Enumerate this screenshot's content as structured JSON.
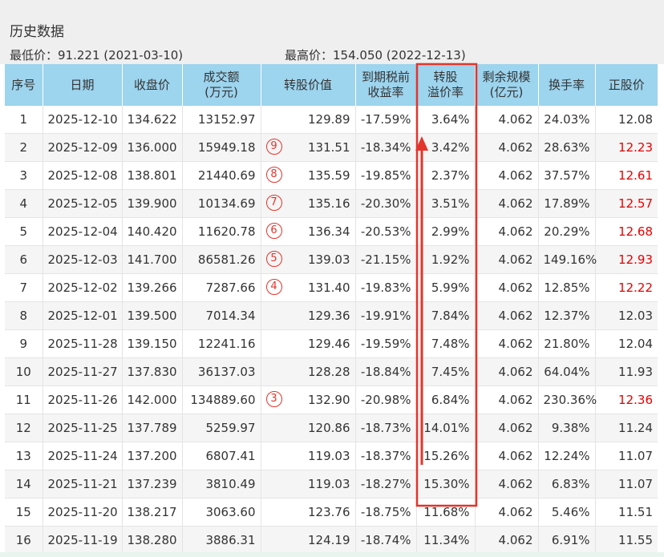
{
  "title": "历史数据",
  "low_price": "最低价：91.221 (2021-03-10)",
  "high_price": "最高价：154.050 (2022-12-13)",
  "headers": {
    "seq": "序号",
    "date": "日期",
    "close": "收盘价",
    "amount_1": "成交额",
    "amount_2": "(万元)",
    "conv_value": "转股价值",
    "ytm_1": "到期税前",
    "ytm_2": "收益率",
    "premium_1": "转股",
    "premium_2": "溢价率",
    "remaining_1": "剩余规模",
    "remaining_2": "(亿元)",
    "turnover": "换手率",
    "stock_price": "正股价"
  },
  "rows": [
    {
      "seq": "1",
      "date": "2025-12-10",
      "close": "134.622",
      "amount": "13152.97",
      "mark": "",
      "conv_value": "129.89",
      "ytm": "-17.59%",
      "premium": "3.64%",
      "remaining": "4.062",
      "turnover": "24.03%",
      "stock_price": "12.08",
      "stock_red": false
    },
    {
      "seq": "2",
      "date": "2025-12-09",
      "close": "136.000",
      "amount": "15949.18",
      "mark": "9",
      "conv_value": "131.51",
      "ytm": "-18.34%",
      "premium": "3.42%",
      "remaining": "4.062",
      "turnover": "28.63%",
      "stock_price": "12.23",
      "stock_red": true
    },
    {
      "seq": "3",
      "date": "2025-12-08",
      "close": "138.801",
      "amount": "21440.69",
      "mark": "8",
      "conv_value": "135.59",
      "ytm": "-19.85%",
      "premium": "2.37%",
      "remaining": "4.062",
      "turnover": "37.57%",
      "stock_price": "12.61",
      "stock_red": true
    },
    {
      "seq": "4",
      "date": "2025-12-05",
      "close": "139.900",
      "amount": "10134.69",
      "mark": "7",
      "conv_value": "135.16",
      "ytm": "-20.30%",
      "premium": "3.51%",
      "remaining": "4.062",
      "turnover": "17.89%",
      "stock_price": "12.57",
      "stock_red": true
    },
    {
      "seq": "5",
      "date": "2025-12-04",
      "close": "140.420",
      "amount": "11620.78",
      "mark": "6",
      "conv_value": "136.34",
      "ytm": "-20.53%",
      "premium": "2.99%",
      "remaining": "4.062",
      "turnover": "20.29%",
      "stock_price": "12.68",
      "stock_red": true
    },
    {
      "seq": "6",
      "date": "2025-12-03",
      "close": "141.700",
      "amount": "86581.26",
      "mark": "5",
      "conv_value": "139.03",
      "ytm": "-21.15%",
      "premium": "1.92%",
      "remaining": "4.062",
      "turnover": "149.16%",
      "stock_price": "12.93",
      "stock_red": true
    },
    {
      "seq": "7",
      "date": "2025-12-02",
      "close": "139.266",
      "amount": "7287.66",
      "mark": "4",
      "conv_value": "131.40",
      "ytm": "-19.83%",
      "premium": "5.99%",
      "remaining": "4.062",
      "turnover": "12.85%",
      "stock_price": "12.22",
      "stock_red": true
    },
    {
      "seq": "8",
      "date": "2025-12-01",
      "close": "139.500",
      "amount": "7014.34",
      "mark": "",
      "conv_value": "129.36",
      "ytm": "-19.91%",
      "premium": "7.84%",
      "remaining": "4.062",
      "turnover": "12.37%",
      "stock_price": "12.03",
      "stock_red": false
    },
    {
      "seq": "9",
      "date": "2025-11-28",
      "close": "139.150",
      "amount": "12241.16",
      "mark": "",
      "conv_value": "129.46",
      "ytm": "-19.59%",
      "premium": "7.48%",
      "remaining": "4.062",
      "turnover": "21.80%",
      "stock_price": "12.04",
      "stock_red": false
    },
    {
      "seq": "10",
      "date": "2025-11-27",
      "close": "137.830",
      "amount": "36137.03",
      "mark": "",
      "conv_value": "128.28",
      "ytm": "-18.84%",
      "premium": "7.45%",
      "remaining": "4.062",
      "turnover": "64.04%",
      "stock_price": "11.93",
      "stock_red": false
    },
    {
      "seq": "11",
      "date": "2025-11-26",
      "close": "142.000",
      "amount": "134889.60",
      "mark": "3",
      "conv_value": "132.90",
      "ytm": "-20.98%",
      "premium": "6.84%",
      "remaining": "4.062",
      "turnover": "230.36%",
      "stock_price": "12.36",
      "stock_red": true
    },
    {
      "seq": "12",
      "date": "2025-11-25",
      "close": "137.789",
      "amount": "5259.97",
      "mark": "",
      "conv_value": "120.86",
      "ytm": "-18.73%",
      "premium": "14.01%",
      "remaining": "4.062",
      "turnover": "9.38%",
      "stock_price": "11.24",
      "stock_red": false
    },
    {
      "seq": "13",
      "date": "2025-11-24",
      "close": "137.200",
      "amount": "6807.41",
      "mark": "",
      "conv_value": "119.03",
      "ytm": "-18.37%",
      "premium": "15.26%",
      "remaining": "4.062",
      "turnover": "12.24%",
      "stock_price": "11.07",
      "stock_red": false
    },
    {
      "seq": "14",
      "date": "2025-11-21",
      "close": "137.239",
      "amount": "3810.49",
      "mark": "",
      "conv_value": "119.03",
      "ytm": "-18.27%",
      "premium": "15.30%",
      "remaining": "4.062",
      "turnover": "6.83%",
      "stock_price": "11.07",
      "stock_red": false
    },
    {
      "seq": "15",
      "date": "2025-11-20",
      "close": "138.217",
      "amount": "3063.60",
      "mark": "",
      "conv_value": "123.76",
      "ytm": "-18.75%",
      "premium": "11.68%",
      "remaining": "4.062",
      "turnover": "5.46%",
      "stock_price": "11.51",
      "stock_red": false
    },
    {
      "seq": "16",
      "date": "2025-11-19",
      "close": "138.280",
      "amount": "3886.31",
      "mark": "",
      "conv_value": "124.19",
      "ytm": "-18.74%",
      "premium": "11.34%",
      "remaining": "4.062",
      "turnover": "6.91%",
      "stock_price": "11.55",
      "stock_red": false
    }
  ],
  "colors": {
    "header_bg": "#9dd4ee",
    "title_bg": "#efefef",
    "highlight_red": "#e3352b",
    "price_up_red": "#e60000"
  },
  "annotations": {
    "highlight_box": "premium-column rows 1-14",
    "arrow_direction": "up"
  }
}
